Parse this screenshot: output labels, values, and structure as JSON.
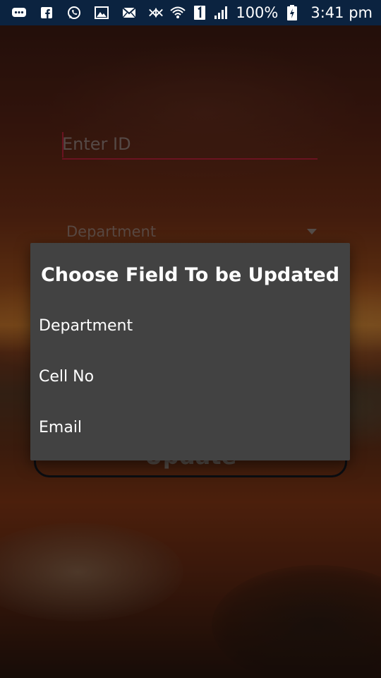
{
  "status_bar": {
    "notification_icons": [
      "messaging-icon",
      "facebook-icon",
      "whatsapp-icon",
      "gallery-icon",
      "mail-icon"
    ],
    "system_icons": [
      "mute-icon",
      "wifi-icon",
      "sim-1-icon",
      "signal-icon",
      "battery-charging-icon"
    ],
    "battery_percent": "100%",
    "time": "3:41 pm",
    "background_color": "#0b2340"
  },
  "form": {
    "id_input": {
      "placeholder": "Enter ID",
      "value": ""
    },
    "department_spinner": {
      "selected": "Department"
    },
    "update_button": {
      "label": "Update"
    }
  },
  "dialog": {
    "title": "Choose Field To be Updated",
    "options": [
      "Department",
      "Cell No",
      "Email"
    ],
    "background_color": "#424242"
  },
  "colors": {
    "accent": "#c4243c",
    "text_on_dialog": "#ffffff"
  }
}
